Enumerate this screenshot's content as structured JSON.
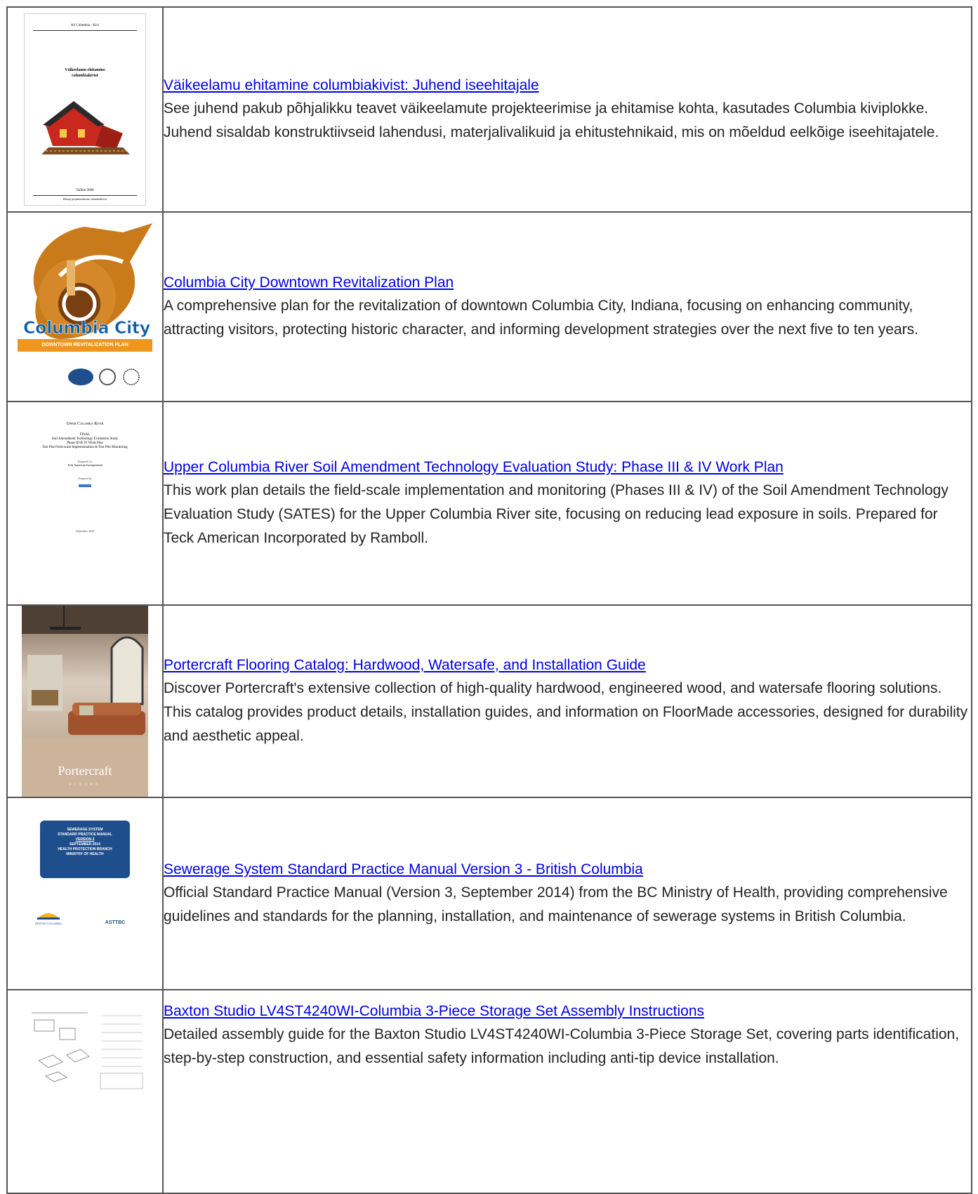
{
  "results": [
    {
      "title": "Väikeelamu ehitamine columbiakivist: Juhend iseehitajale",
      "description": "See juhend pakub põhjalikku teavet väikeelamute projekteerimise ja ehitamise kohta, kasutades Columbia kiviplokke. Juhend sisaldab konstruktiivseid lahendusi, materjalivalikuid ja ehitustehnikaid, mis on mõeldud eelkõige iseehitajatele.",
      "thumb": {
        "header": "AS Columbia - Kivi",
        "title_line1": "Väikeelamu ehitamine",
        "title_line2": "columbiakivist",
        "footer": "Tallinn 2000",
        "footer2": "Ehitaja projekteerimine columbiakivist"
      }
    },
    {
      "title": "Columbia City Downtown Revitalization Plan",
      "description": "A comprehensive plan for the revitalization of downtown Columbia City, Indiana, focusing on enhancing community, attracting visitors, protecting historic character, and informing development strategies over the next five to ten years.",
      "thumb": {
        "wordmark": "Columbia City",
        "banner": "DOWNTOWN REVITALIZATION PLAN"
      }
    },
    {
      "title": "Upper Columbia River Soil Amendment Technology Evaluation Study: Phase III & IV Work Plan",
      "description": "This work plan details the field-scale implementation and monitoring (Phases III & IV) of the Soil Amendment Technology Evaluation Study (SATES) for the Upper Columbia River site, focusing on reducing lead exposure in soils. Prepared for Teck American Incorporated by Ramboll.",
      "thumb": {
        "heading": "Upper Columbia River",
        "line1": "FINAL",
        "line2": "Soil Amendment Technology Evaluation Study",
        "line3": "Phase III & IV Work Plan",
        "line4": "Test Plot Field-scale Implementation & Test Plot Monitoring",
        "prepared_for": "Prepared for",
        "client": "Teck American Incorporated",
        "prepared_by": "Prepared by",
        "date": "September 2020"
      }
    },
    {
      "title": "Portercraft Flooring Catalog: Hardwood, Watersafe, and Installation Guide",
      "description": "Discover Portercraft's extensive collection of high-quality hardwood, engineered wood, and watersafe flooring solutions. This catalog provides product details, installation guides, and information on FloorMade accessories, designed for durability and aesthetic appeal.",
      "thumb": {
        "brand": "Portercraft",
        "sub": "FLOORS"
      }
    },
    {
      "title": "Sewerage System Standard Practice Manual Version 3 - British Columbia",
      "description": "Official Standard Practice Manual (Version 3, September 2014) from the BC Ministry of Health, providing comprehensive guidelines and standards for the planning, installation, and maintenance of sewerage systems in British Columbia.",
      "thumb": {
        "p1": "SEWERAGE SYSTEM",
        "p2": "STANDARD PRACTICE MANUAL",
        "p3": "VERSION 3",
        "p4": "SEPTEMBER 2014",
        "p5": "HEALTH PROTECTION BRANCH",
        "p6": "MINISTRY OF HEALTH",
        "logo_left": "BRITISH COLUMBIA",
        "logo_right": "ASTTBC"
      }
    },
    {
      "title": "Baxton Studio LV4ST4240WI-Columbia 3-Piece Storage Set Assembly Instructions",
      "description": "Detailed assembly guide for the Baxton Studio LV4ST4240WI-Columbia 3-Piece Storage Set, covering parts identification, step-by-step construction, and essential safety information including anti-tip device installation.",
      "thumb": {}
    }
  ],
  "colors": {
    "link": "#0000ee",
    "text": "#222222",
    "border": "#555555",
    "banner_orange": "#f0961e",
    "manual_blue": "#1f4e8c"
  }
}
